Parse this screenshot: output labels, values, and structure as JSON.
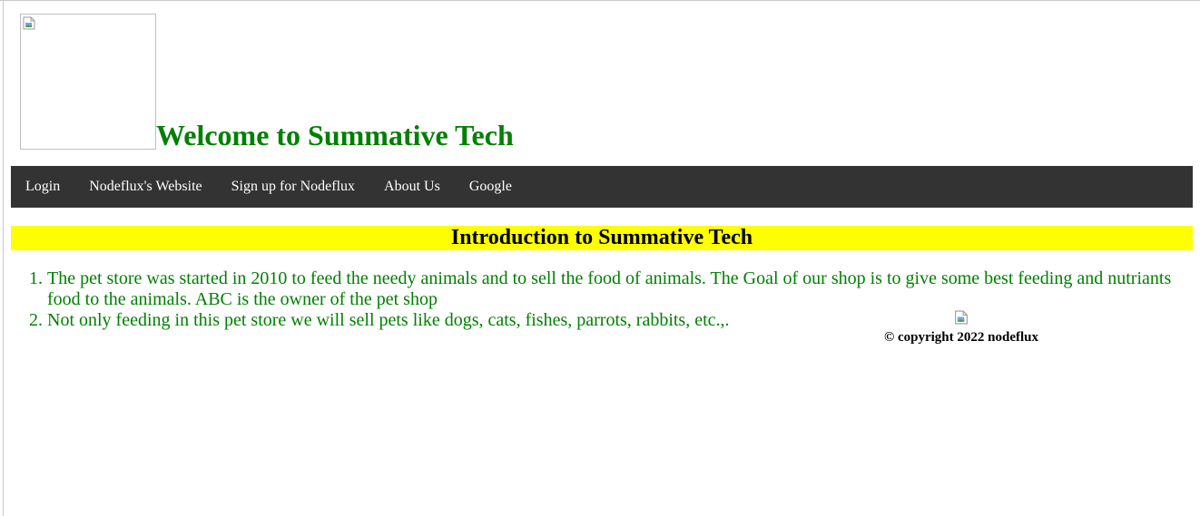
{
  "header": {
    "logo_icon": "broken-image-icon",
    "title": "Welcome to Summative Tech",
    "title_color": "#008000"
  },
  "navbar": {
    "background": "#333333",
    "links": [
      {
        "label": "Login"
      },
      {
        "label": "Nodeflux's Website"
      },
      {
        "label": "Sign up for Nodeflux"
      },
      {
        "label": "About Us"
      },
      {
        "label": "Google"
      }
    ]
  },
  "intro": {
    "title": "Introduction to Summative Tech",
    "background": "#ffff00"
  },
  "content": {
    "items": [
      "The pet store was started in 2010 to feed the needy animals and to sell the food of animals. The Goal of our shop is to give some best feeding and nutriants food to the animals. ABC is the owner of the pet shop",
      "Not only feeding in this pet store we will sell pets like dogs, cats, fishes, parrots, rabbits, etc.,."
    ],
    "text_color": "#008000"
  },
  "footer": {
    "image_icon": "broken-image-icon",
    "copyright": "© copyright 2022 nodeflux"
  }
}
